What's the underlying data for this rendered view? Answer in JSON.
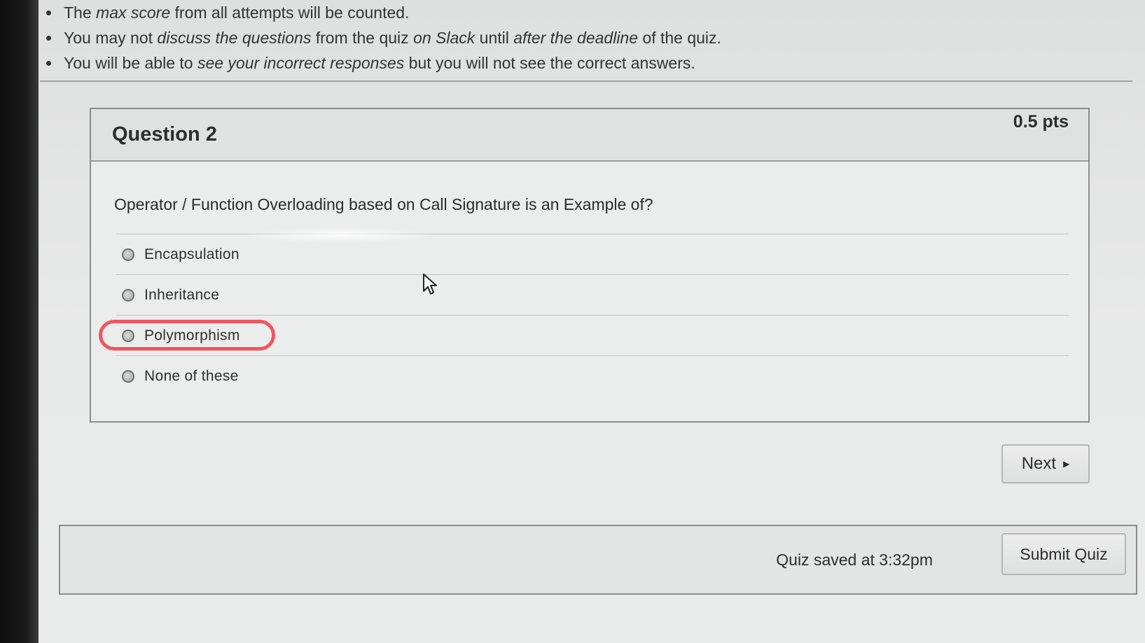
{
  "instructions": [
    {
      "lead": "The ",
      "em1": "max score",
      "rest1": " from all attempts will be counted.",
      "em2": "",
      "rest2": "",
      "em3": "",
      "rest3": ""
    },
    {
      "lead": "You may not ",
      "em1": "discuss the questions",
      "rest1": " from the quiz ",
      "em2": "on Slack",
      "rest2": " until ",
      "em3": "after the deadline",
      "rest3": " of the quiz."
    },
    {
      "lead": "You will be able to ",
      "em1": "see your incorrect responses",
      "rest1": " but you will not see the correct answers.",
      "em2": "",
      "rest2": "",
      "em3": "",
      "rest3": ""
    }
  ],
  "question": {
    "title": "Question 2",
    "points": "0.5 pts",
    "text": "Operator / Function Overloading based on Call Signature is an Example of?",
    "answers": [
      "Encapsulation",
      "Inheritance",
      "Polymorphism",
      "None of these"
    ],
    "highlighted_answer": "Polymorphism",
    "highlight_color": "#ef5561"
  },
  "navigation": {
    "next_label": "Next",
    "next_icon": "triangle-right-icon"
  },
  "footer": {
    "saved_text": "Quiz saved at 3:32pm",
    "submit_label": "Submit Quiz"
  }
}
